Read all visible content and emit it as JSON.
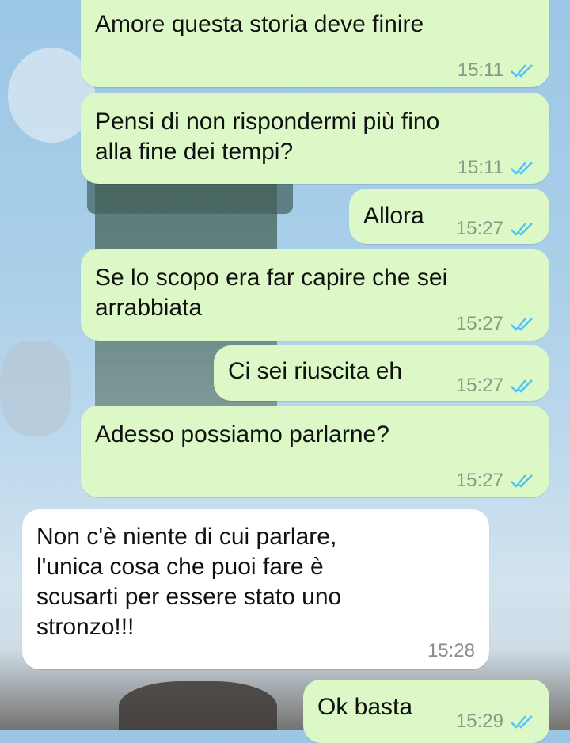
{
  "messages": [
    {
      "id": "m1",
      "direction": "out",
      "text": "Amore questa storia deve finire",
      "time": "15:11",
      "status": "read"
    },
    {
      "id": "m2",
      "direction": "out",
      "text": "Pensi di non rispondermi più fino\nalla fine dei tempi?",
      "time": "15:11",
      "status": "read"
    },
    {
      "id": "m3",
      "direction": "out",
      "text": "Allora",
      "time": "15:27",
      "status": "read"
    },
    {
      "id": "m4",
      "direction": "out",
      "text": "Se lo scopo era far capire che sei\narrabbiata",
      "time": "15:27",
      "status": "read"
    },
    {
      "id": "m5",
      "direction": "out",
      "text": "Ci sei riuscita eh",
      "time": "15:27",
      "status": "read"
    },
    {
      "id": "m6",
      "direction": "out",
      "text": "Adesso possiamo parlarne?",
      "time": "15:27",
      "status": "read"
    },
    {
      "id": "m7",
      "direction": "in",
      "text": "Non c'è niente di cui parlare,\nl'unica cosa che puoi fare è\nscusarti per essere stato uno\nstronzo!!!",
      "time": "15:28"
    },
    {
      "id": "m8",
      "direction": "out",
      "text": "Ok basta",
      "time": "15:29",
      "status": "read"
    }
  ],
  "colors": {
    "outgoing_bubble": "#dcf8c6",
    "incoming_bubble": "#ffffff",
    "read_ticks": "#4fc3f7"
  },
  "icons": {
    "read_status": "double-check-icon"
  }
}
